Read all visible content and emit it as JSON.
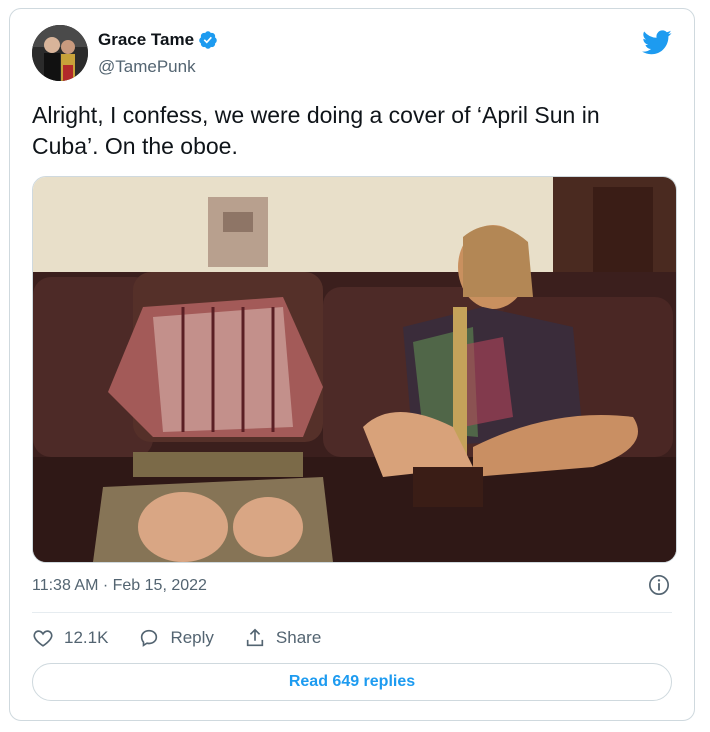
{
  "author": {
    "name": "Grace Tame",
    "handle": "@TamePunk",
    "verified": true
  },
  "tweet": {
    "text": "Alright, I confess, we were doing a cover of ‘April Sun in Cuba’. On the oboe.",
    "timestamp": "11:38 AM · Feb 15, 2022"
  },
  "media": {
    "description_icon": "photo"
  },
  "actions": {
    "like_count": "12.1K",
    "reply_label": "Reply",
    "share_label": "Share"
  },
  "read_replies_label": "Read 649 replies",
  "colors": {
    "accent": "#1d9bf0",
    "text_primary": "#0f1419",
    "text_secondary": "#536471",
    "border": "#cfd9de"
  },
  "icons": [
    "twitter-bird-icon",
    "verified-badge-icon",
    "info-icon",
    "heart-icon",
    "reply-icon",
    "share-icon"
  ]
}
